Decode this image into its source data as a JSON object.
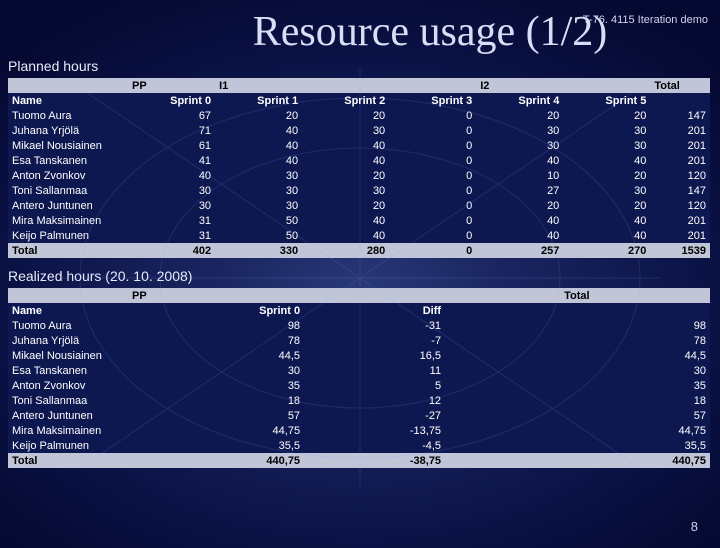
{
  "header": {
    "course": "T-76. 4115 Iteration demo"
  },
  "title": "Resource usage (1/2)",
  "sections": {
    "planned_label": "Planned hours",
    "realized_label": "Realized hours (20. 10. 2008)"
  },
  "planned": {
    "group_headers": [
      "",
      "PP",
      "I1",
      "",
      "",
      "I2",
      "",
      "Total"
    ],
    "col_headers": [
      "Name",
      "Sprint 0",
      "Sprint 1",
      "Sprint 2",
      "Sprint 3",
      "Sprint 4",
      "Sprint 5",
      ""
    ],
    "rows": [
      {
        "name": "Tuomo Aura",
        "v": [
          "67",
          "20",
          "20",
          "0",
          "20",
          "20",
          "147"
        ]
      },
      {
        "name": "Juhana Yrjölä",
        "v": [
          "71",
          "40",
          "30",
          "0",
          "30",
          "30",
          "201"
        ]
      },
      {
        "name": "Mikael Nousiainen",
        "v": [
          "61",
          "40",
          "40",
          "0",
          "30",
          "30",
          "201"
        ]
      },
      {
        "name": "Esa Tanskanen",
        "v": [
          "41",
          "40",
          "40",
          "0",
          "40",
          "40",
          "201"
        ]
      },
      {
        "name": "Anton Zvonkov",
        "v": [
          "40",
          "30",
          "20",
          "0",
          "10",
          "20",
          "120"
        ]
      },
      {
        "name": "Toni Sallanmaa",
        "v": [
          "30",
          "30",
          "30",
          "0",
          "27",
          "30",
          "147"
        ]
      },
      {
        "name": "Antero Juntunen",
        "v": [
          "30",
          "30",
          "20",
          "0",
          "20",
          "20",
          "120"
        ]
      },
      {
        "name": "Mira Maksimainen",
        "v": [
          "31",
          "50",
          "40",
          "0",
          "40",
          "40",
          "201"
        ]
      },
      {
        "name": "Keijo Palmunen",
        "v": [
          "31",
          "50",
          "40",
          "0",
          "40",
          "40",
          "201"
        ]
      }
    ],
    "total": {
      "name": "Total",
      "v": [
        "402",
        "330",
        "280",
        "0",
        "257",
        "270",
        "1539"
      ]
    }
  },
  "realized": {
    "group_headers": [
      "",
      "PP",
      "",
      "",
      "",
      "",
      "",
      "Total"
    ],
    "col_headers": [
      "Name",
      "Sprint 0",
      "Diff",
      "",
      "",
      "",
      "",
      ""
    ],
    "rows": [
      {
        "name": "Tuomo Aura",
        "v": [
          "98",
          "-31",
          "",
          "",
          "",
          "",
          "98"
        ]
      },
      {
        "name": "Juhana Yrjölä",
        "v": [
          "78",
          "-7",
          "",
          "",
          "",
          "",
          "78"
        ]
      },
      {
        "name": "Mikael Nousiainen",
        "v": [
          "44,5",
          "16,5",
          "",
          "",
          "",
          "",
          "44,5"
        ]
      },
      {
        "name": "Esa Tanskanen",
        "v": [
          "30",
          "11",
          "",
          "",
          "",
          "",
          "30"
        ]
      },
      {
        "name": "Anton Zvonkov",
        "v": [
          "35",
          "5",
          "",
          "",
          "",
          "",
          "35"
        ]
      },
      {
        "name": "Toni Sallanmaa",
        "v": [
          "18",
          "12",
          "",
          "",
          "",
          "",
          "18"
        ]
      },
      {
        "name": "Antero Juntunen",
        "v": [
          "57",
          "-27",
          "",
          "",
          "",
          "",
          "57"
        ]
      },
      {
        "name": "Mira Maksimainen",
        "v": [
          "44,75",
          "-13,75",
          "",
          "",
          "",
          "",
          "44,75"
        ]
      },
      {
        "name": "Keijo Palmunen",
        "v": [
          "35,5",
          "-4,5",
          "",
          "",
          "",
          "",
          "35,5"
        ]
      }
    ],
    "total": {
      "name": "Total",
      "v": [
        "440,75",
        "-38,75",
        "",
        "",
        "",
        "",
        "440,75"
      ]
    }
  },
  "page_number": "8"
}
